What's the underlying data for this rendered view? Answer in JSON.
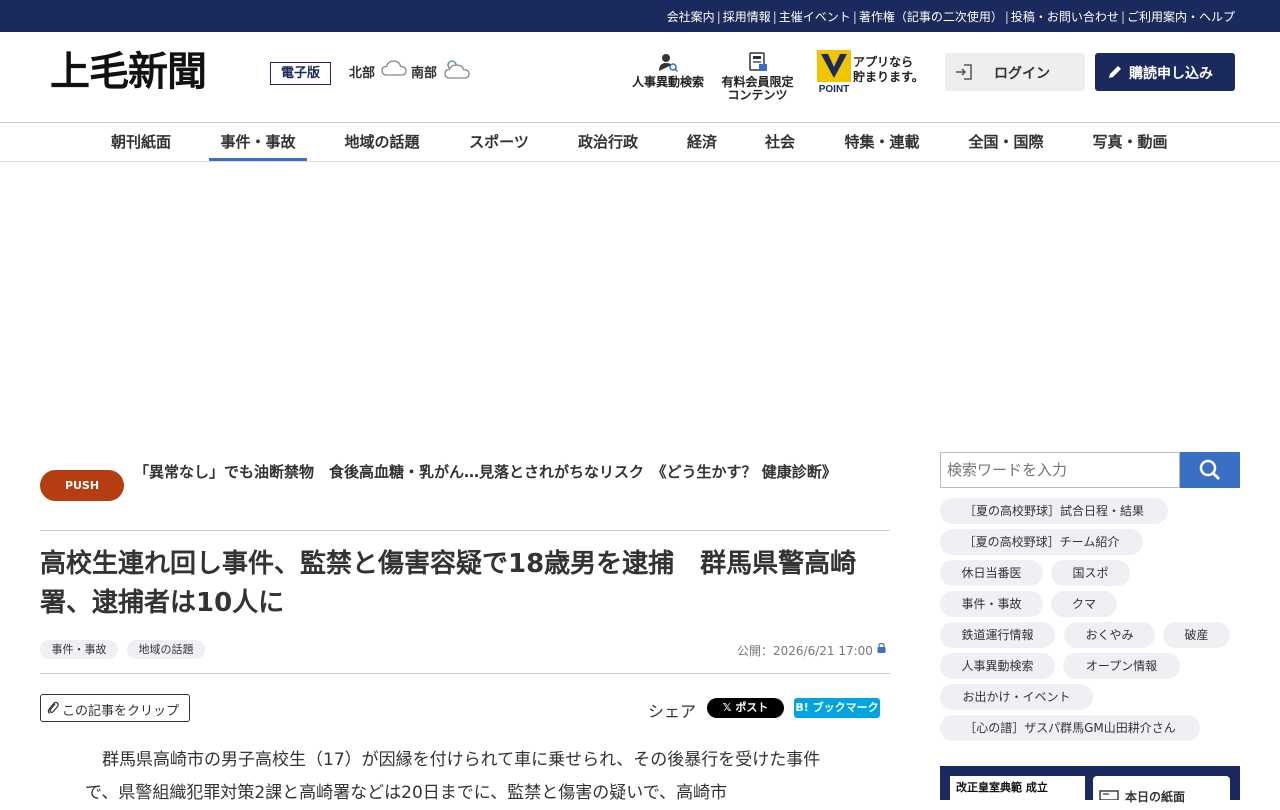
{
  "topbar": {
    "links": [
      "会社案内",
      "採用情報",
      "主催イベント",
      "著作権（記事の二次使用）",
      "投稿・お問い合わせ",
      "ご利用案内・ヘルプ"
    ]
  },
  "header": {
    "logo": "上毛新聞",
    "logo_sub": "電子版",
    "weather": [
      {
        "region": "北部",
        "icon": "cloud-icon"
      },
      {
        "region": "南部",
        "icon": "cloud-sun-icon"
      }
    ],
    "personnel_search": "人事異動検索",
    "member_content_line1": "有料会員限定",
    "member_content_line2": "コンテンツ",
    "vpoint_label": "POINT",
    "app_line1": "アプリなら",
    "app_line2": "貯まります。",
    "login_label": "ログイン",
    "subscribe_label": "購読申し込み"
  },
  "nav": {
    "items": [
      "朝刊紙面",
      "事件・事故",
      "地域の話題",
      "スポーツ",
      "政治行政",
      "経済",
      "社会",
      "特集・連載",
      "全国・国際",
      "写真・動画"
    ],
    "active_index": 1
  },
  "push": {
    "badge": "PUSH",
    "text": "「異常なし」でも油断禁物　食後高血糖・乳がん…見落とされがちなリスク　《どう生かす？ 健康診断》"
  },
  "article": {
    "title": "高校生連れ回し事件、監禁と傷害容疑で18歳男を逮捕　群馬県警高崎署、逮捕者は10人に",
    "tags": [
      "事件・事故",
      "地域の話題"
    ],
    "published": "公開：2026/6/21 17:00",
    "clip_label": "この記事をクリップ",
    "share_label": "シェア",
    "x_post": "𝕏 ポスト",
    "hatena": "B! ブックマーク",
    "body": "群馬県高崎市の男子高校生（17）が因縁を付けられて車に乗せられ、その後暴行を受けた事件で、県警組織犯罪対策2課と高崎署などは20日までに、監禁と傷害の疑いで、高崎市"
  },
  "sidebar": {
    "search_placeholder": "検索ワードを入力",
    "keywords": [
      "［夏の高校野球］試合日程・結果",
      "［夏の高校野球］チーム紹介",
      "休日当番医",
      "国スポ",
      "事件・事故",
      "クマ",
      "鉄道運行情報",
      "おくやみ",
      "破産",
      "人事異動検索",
      "オープン情報",
      "お出かけ・イベント",
      "［心の譜］ザスパ群馬GM山田耕介さん"
    ],
    "paper_headline": "改正皇室典範 成立",
    "paper_label": "本日の紙面"
  },
  "colors": {
    "navy": "#1b2a5c",
    "accent_blue": "#3b6fc6",
    "push_badge": "#b63c12",
    "hatena": "#00a4de"
  }
}
